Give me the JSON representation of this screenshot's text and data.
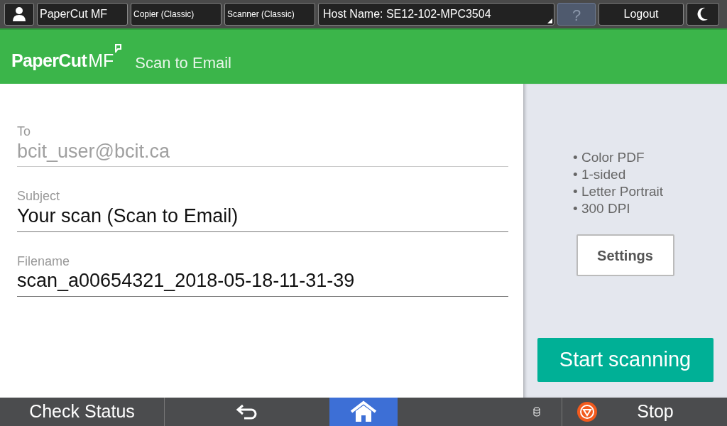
{
  "top_bar": {
    "items": [
      {
        "label": "PaperCut MF"
      },
      {
        "label": "Copier (Classic)"
      },
      {
        "label": "Scanner (Classic)"
      }
    ],
    "host": "Host Name: SE12-102-MPC3504",
    "help": {
      "label": "?",
      "disabled": true
    },
    "logout": "Logout"
  },
  "header": {
    "logo": {
      "name": "PaperCut",
      "suffix": "MF"
    },
    "title": "Scan to Email"
  },
  "fields": [
    {
      "label": "To",
      "value": "bcit_user@bcit.ca",
      "disabled": true
    },
    {
      "label": "Subject",
      "value": "Your scan (Scan to Email)",
      "disabled": false
    },
    {
      "label": "Filename",
      "value": "scan_a00654321_2018-05-18-11-31-39",
      "disabled": false
    }
  ],
  "summary": [
    "• Color PDF",
    "• 1-sided",
    "• Letter Portrait",
    "• 300 DPI"
  ],
  "settings_button": "Settings",
  "start_button": "Start scanning",
  "bottom_bar": {
    "check_status": "Check Status",
    "home_selected": true,
    "stop": "Stop"
  }
}
